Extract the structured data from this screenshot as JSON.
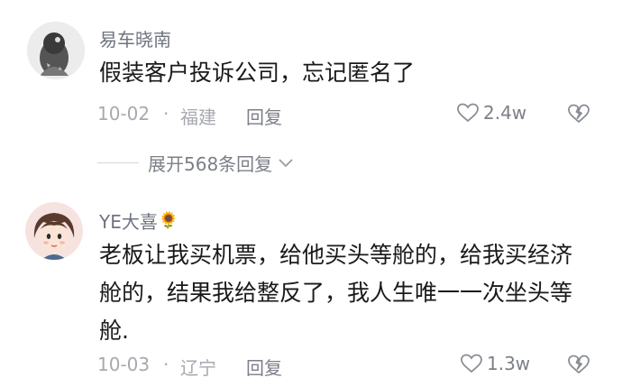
{
  "comments": [
    {
      "username": "易车晓南",
      "text": "假装客户投诉公司，忘记匿名了",
      "date": "10-02",
      "location": "福建",
      "reply_label": "回复",
      "likes": "2.4w"
    },
    {
      "username": "YE大喜",
      "username_emoji": "🌻",
      "text_lines": [
        "老板让我买机票，给他买头等舱的，给我买经济",
        "舱的，结果我给整反了，我人生唯一一次坐头等",
        "舱."
      ],
      "date": "10-03",
      "location": "辽宁",
      "reply_label": "回复",
      "likes": "1.3w"
    }
  ],
  "expand_replies": "展开568条回复",
  "separator_dot": "·"
}
